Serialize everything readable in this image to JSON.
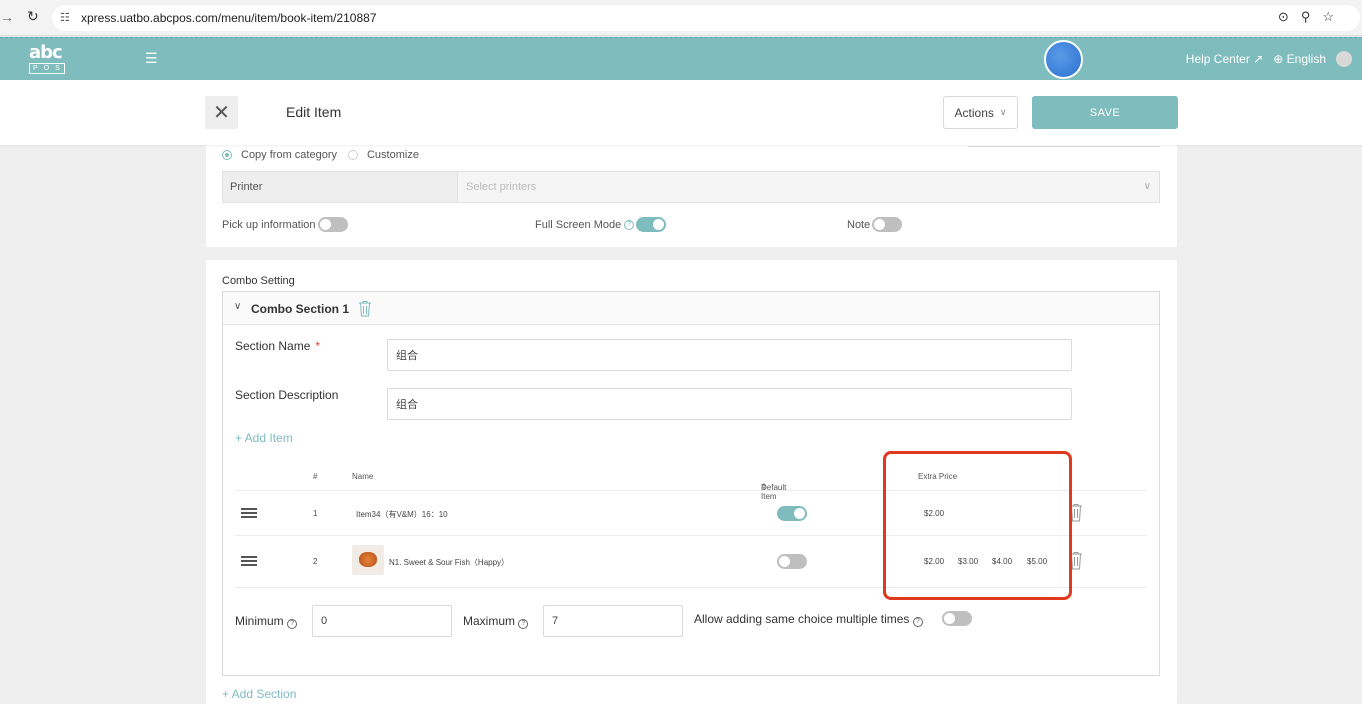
{
  "browser": {
    "url": "xpress.uatbo.abcpos.com/menu/item/book-item/210887"
  },
  "header": {
    "logo_top": "abc",
    "logo_bottom": "POS",
    "help_center": "Help Center",
    "language": "English"
  },
  "topbar": {
    "title": "Edit Item",
    "actions_label": "Actions",
    "save_label": "SAVE"
  },
  "card1": {
    "radio_copy": "Copy from category",
    "radio_customize": "Customize",
    "printer_label": "Printer",
    "printer_placeholder": "Select printers",
    "pickup_label": "Pick up information",
    "fullscreen_label": "Full Screen Mode",
    "note_label": "Note"
  },
  "combo": {
    "setting_title": "Combo Setting",
    "section_title": "Combo Section 1",
    "section_name_label": "Section Name",
    "section_name_value": "组合",
    "section_desc_label": "Section Description",
    "section_desc_value": "组合",
    "add_item": "+ Add Item",
    "columns": {
      "index": "#",
      "name": "Name",
      "default_item": "Default Item",
      "extra_price": "Extra Price"
    },
    "rows": [
      {
        "index": "1",
        "name": "Item34（有V&M）16：10",
        "default_on": true,
        "prices": [
          "$2.00"
        ]
      },
      {
        "index": "2",
        "name": "N1. Sweet & Sour Fish（Happy）",
        "default_on": false,
        "prices": [
          "$2.00",
          "$3.00",
          "$4.00",
          "$5.00"
        ]
      }
    ],
    "minimum_label": "Minimum",
    "minimum_value": "0",
    "maximum_label": "Maximum",
    "maximum_value": "7",
    "allow_same_label": "Allow adding same choice multiple times",
    "add_section": "+ Add Section"
  },
  "colors": {
    "accent": "#7fbcbd",
    "highlight": "#e0391d"
  }
}
